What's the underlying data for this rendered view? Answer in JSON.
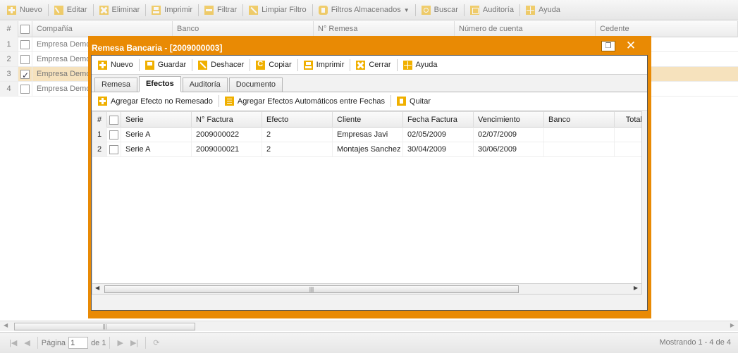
{
  "main_toolbar": {
    "nuevo": "Nuevo",
    "editar": "Editar",
    "eliminar": "Eliminar",
    "imprimir": "Imprimir",
    "filtrar": "Filtrar",
    "limpiar_filtro": "Limpiar Filtro",
    "filtros_almacenados": "Filtros Almacenados",
    "buscar": "Buscar",
    "auditoria": "Auditoría",
    "ayuda": "Ayuda"
  },
  "grid": {
    "headers": {
      "num": "#",
      "compania": "Compañía",
      "banco": "Banco",
      "remesa": "N° Remesa",
      "cuenta": "Número de cuenta",
      "cedente": "Cedente"
    },
    "rows": [
      {
        "num": "1",
        "compania": "Empresa Demo",
        "checked": false
      },
      {
        "num": "2",
        "compania": "Empresa Demo",
        "checked": false
      },
      {
        "num": "3",
        "compania": "Empresa Demo",
        "checked": true
      },
      {
        "num": "4",
        "compania": "Empresa Demo",
        "checked": false
      }
    ]
  },
  "pager": {
    "pagina_label": "Página",
    "page_value": "1",
    "de_label": "de 1",
    "info": "Mostrando 1 - 4 de 4"
  },
  "modal": {
    "title": "Remesa Bancaria - [2009000003]",
    "toolbar": {
      "nuevo": "Nuevo",
      "guardar": "Guardar",
      "deshacer": "Deshacer",
      "copiar": "Copiar",
      "imprimir": "Imprimir",
      "cerrar": "Cerrar",
      "ayuda": "Ayuda"
    },
    "tabs": [
      "Remesa",
      "Efectos",
      "Auditoría",
      "Documento"
    ],
    "active_tab": "Efectos",
    "sub_toolbar": {
      "agregar_efecto": "Agregar Efecto no Remesado",
      "agregar_auto": "Agregar Efectos Automáticos entre Fechas",
      "quitar": "Quitar"
    },
    "grid": {
      "headers": {
        "num": "#",
        "serie": "Serie",
        "factura": "N° Factura",
        "efecto": "Efecto",
        "cliente": "Cliente",
        "fecha_factura": "Fecha Factura",
        "vencimiento": "Vencimiento",
        "banco": "Banco",
        "total": "Total"
      },
      "rows": [
        {
          "num": "1",
          "serie": "Serie A",
          "factura": "2009000022",
          "efecto": "2",
          "cliente": "Empresas Javi",
          "fecha_factura": "02/05/2009",
          "vencimiento": "02/07/2009",
          "banco": ""
        },
        {
          "num": "2",
          "serie": "Serie A",
          "factura": "2009000021",
          "efecto": "2",
          "cliente": "Montajes Sanchez",
          "fecha_factura": "30/04/2009",
          "vencimiento": "30/06/2009",
          "banco": ""
        }
      ]
    }
  },
  "colors": {
    "modal_accent": "#e98a04",
    "selected_row": "#f6e2bd",
    "icon_accent": "#f0b000"
  }
}
